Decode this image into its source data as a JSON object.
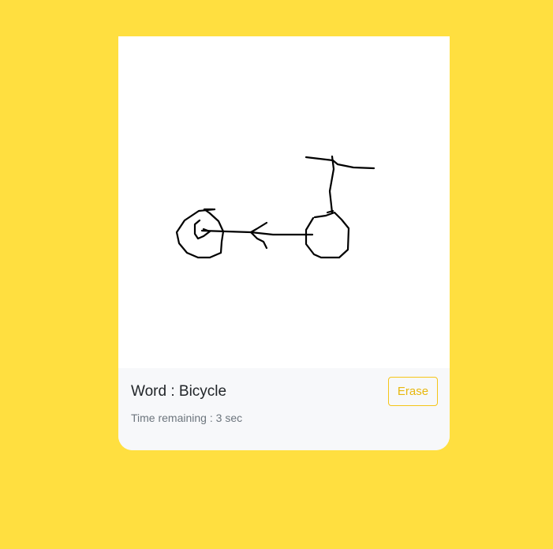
{
  "game": {
    "word_label": "Word",
    "word": "Bicycle",
    "time_label": "Time remaining",
    "time_value": "3",
    "time_unit": "sec",
    "erase_label": "Erase"
  },
  "colors": {
    "background": "#FFDF40",
    "card": "#ffffff",
    "footer": "#F7F8FA",
    "accent": "#F5C518",
    "ink": "#000000"
  }
}
